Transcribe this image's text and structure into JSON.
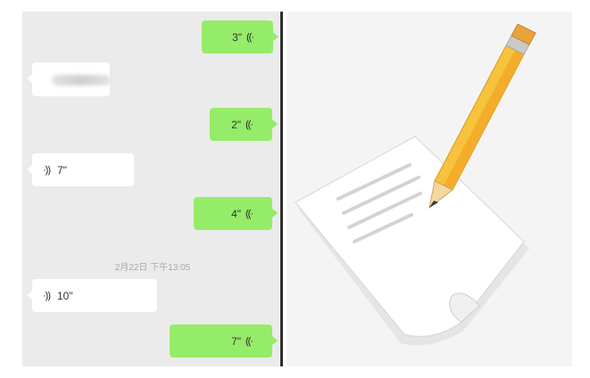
{
  "chat": {
    "messages": [
      {
        "side": "sent",
        "duration": "3\""
      },
      {
        "side": "received",
        "content": "blurred"
      },
      {
        "side": "sent",
        "duration": "2\""
      },
      {
        "side": "received",
        "duration": "7\""
      },
      {
        "side": "sent",
        "duration": "4\""
      },
      {
        "side": "received",
        "duration": "10\""
      },
      {
        "side": "sent",
        "duration": "7\""
      }
    ],
    "timestamp": "2月22日 下午13:05"
  },
  "icons": {
    "voice_out": "((·",
    "voice_in": "·))"
  },
  "illustration": {
    "subject": "pencil-writing-on-paper",
    "colors": {
      "pencil_body": "#f7c23c",
      "pencil_tip": "#f2d9a0",
      "eraser": "#e8a33a",
      "paper": "#ffffff"
    }
  },
  "colors": {
    "sent_bubble": "#95ec69",
    "received_bubble": "#ffffff",
    "chat_bg": "#ebebeb"
  }
}
